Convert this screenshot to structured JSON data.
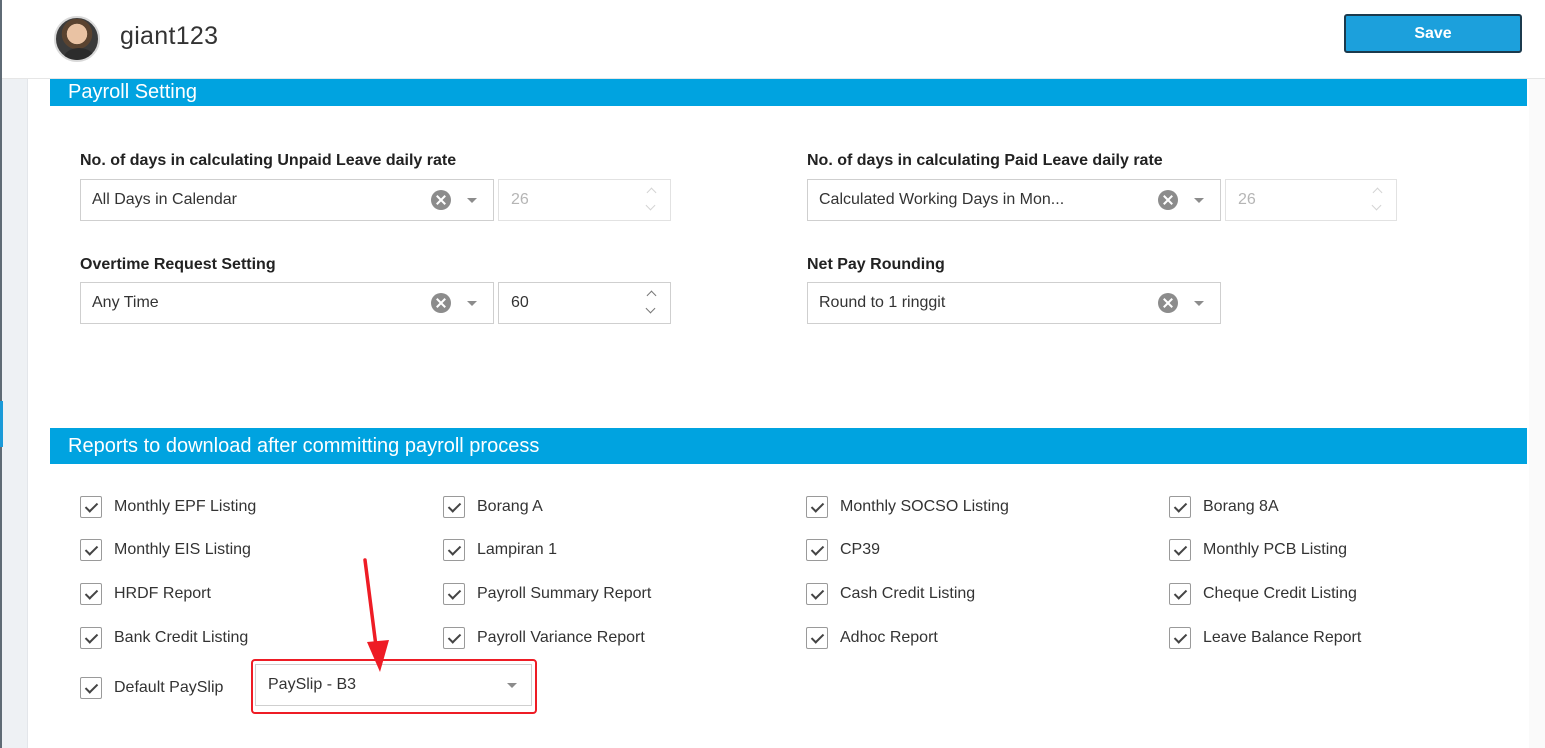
{
  "header": {
    "username": "giant123",
    "save_label": "Save"
  },
  "payroll_setting": {
    "title": "Payroll Setting",
    "unpaid_leave": {
      "label": "No. of days in calculating Unpaid Leave daily rate",
      "value": "All Days in Calendar",
      "days": "26"
    },
    "paid_leave": {
      "label": "No. of days in calculating Paid Leave daily rate",
      "value": "Calculated Working Days in Mon...",
      "days": "26"
    },
    "overtime": {
      "label": "Overtime Request Setting",
      "value": "Any Time",
      "minutes": "60"
    },
    "net_pay_rounding": {
      "label": "Net Pay Rounding",
      "value": "Round to 1 ringgit"
    }
  },
  "reports": {
    "title": "Reports to download after committing payroll process",
    "items": [
      {
        "label": "Monthly EPF Listing",
        "checked": true
      },
      {
        "label": "Borang A",
        "checked": true
      },
      {
        "label": "Monthly SOCSO Listing",
        "checked": true
      },
      {
        "label": "Borang 8A",
        "checked": true
      },
      {
        "label": "Monthly EIS Listing",
        "checked": true
      },
      {
        "label": "Lampiran 1",
        "checked": true
      },
      {
        "label": "CP39",
        "checked": true
      },
      {
        "label": "Monthly PCB Listing",
        "checked": true
      },
      {
        "label": "HRDF Report",
        "checked": true
      },
      {
        "label": "Payroll Summary Report",
        "checked": true
      },
      {
        "label": "Cash Credit Listing",
        "checked": true
      },
      {
        "label": "Cheque Credit Listing",
        "checked": true
      },
      {
        "label": "Bank Credit Listing",
        "checked": true
      },
      {
        "label": "Payroll Variance Report",
        "checked": true
      },
      {
        "label": "Adhoc Report",
        "checked": true
      },
      {
        "label": "Leave Balance Report",
        "checked": true
      }
    ],
    "default_payslip": {
      "label": "Default PaySlip",
      "checked": true,
      "selected": "PaySlip - B3"
    }
  },
  "colors": {
    "accent": "#00a3e0",
    "save_button": "#1ca0dc",
    "annotation": "#ee1c25"
  },
  "icons": [
    "avatar",
    "clear-icon",
    "chevron-down-icon",
    "checkbox-checked-icon",
    "spinner-up-icon",
    "spinner-down-icon",
    "annotation-arrow"
  ]
}
